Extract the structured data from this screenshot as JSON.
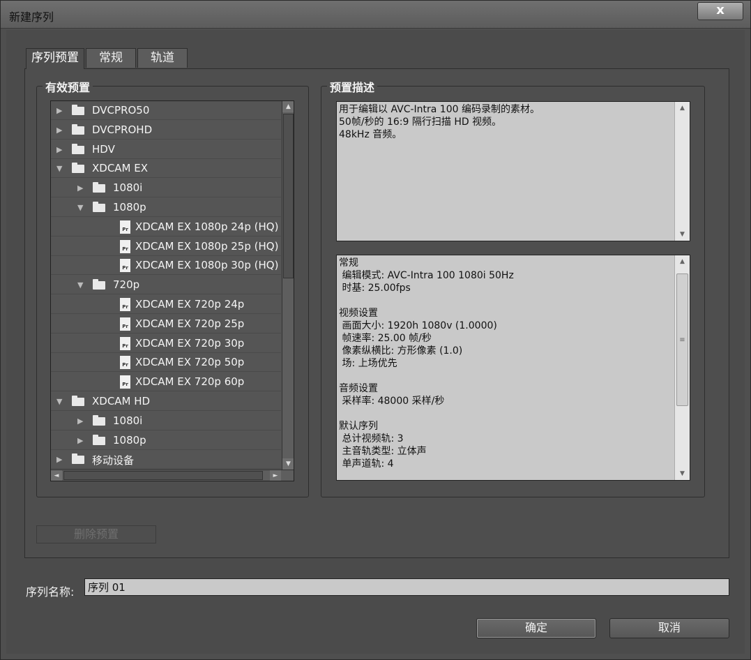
{
  "window": {
    "title": "新建序列",
    "close": "x"
  },
  "tabs": [
    {
      "label": "序列预置",
      "active": true
    },
    {
      "label": "常规",
      "active": false
    },
    {
      "label": "轨道",
      "active": false
    }
  ],
  "presets_group": {
    "label": "有效预置"
  },
  "tree": [
    {
      "label": "DVCPRO50",
      "type": "folder",
      "level": 0,
      "expanded": false
    },
    {
      "label": "DVCPROHD",
      "type": "folder",
      "level": 0,
      "expanded": false
    },
    {
      "label": "HDV",
      "type": "folder",
      "level": 0,
      "expanded": false
    },
    {
      "label": "XDCAM EX",
      "type": "folder",
      "level": 0,
      "expanded": true
    },
    {
      "label": "1080i",
      "type": "folder",
      "level": 1,
      "expanded": false
    },
    {
      "label": "1080p",
      "type": "folder",
      "level": 1,
      "expanded": true
    },
    {
      "label": "XDCAM EX 1080p 24p (HQ)",
      "type": "file",
      "level": 2
    },
    {
      "label": "XDCAM EX 1080p 25p (HQ)",
      "type": "file",
      "level": 2
    },
    {
      "label": "XDCAM EX 1080p 30p (HQ)",
      "type": "file",
      "level": 2
    },
    {
      "label": "720p",
      "type": "folder",
      "level": 1,
      "expanded": true
    },
    {
      "label": "XDCAM EX 720p 24p",
      "type": "file",
      "level": 2
    },
    {
      "label": "XDCAM EX 720p 25p",
      "type": "file",
      "level": 2
    },
    {
      "label": "XDCAM EX 720p 30p",
      "type": "file",
      "level": 2
    },
    {
      "label": "XDCAM EX 720p 50p",
      "type": "file",
      "level": 2
    },
    {
      "label": "XDCAM EX 720p 60p",
      "type": "file",
      "level": 2
    },
    {
      "label": "XDCAM HD",
      "type": "folder",
      "level": 0,
      "expanded": true
    },
    {
      "label": "1080i",
      "type": "folder",
      "level": 1,
      "expanded": false
    },
    {
      "label": "1080p",
      "type": "folder",
      "level": 1,
      "expanded": false
    },
    {
      "label": "移动设备",
      "type": "folder",
      "level": 0,
      "expanded": false
    }
  ],
  "file_icon_text": "Pr",
  "description_group": {
    "label": "预置描述"
  },
  "description_lines": [
    "用于编辑以 AVC-Intra 100 编码录制的素材。",
    "50帧/秒的 16:9 隔行扫描 HD 视频。",
    "48kHz 音频。"
  ],
  "details_lines": [
    "常规",
    " 编辑模式: AVC-Intra 100 1080i 50Hz",
    " 时基: 25.00fps",
    "",
    "视频设置",
    " 画面大小: 1920h 1080v (1.0000)",
    " 帧速率: 25.00 帧/秒",
    " 像素纵横比: 方形像素 (1.0)",
    " 场: 上场优先",
    "",
    "音频设置",
    " 采样率: 48000 采样/秒",
    "",
    "默认序列",
    " 总计视频轨: 3",
    " 主音轨类型: 立体声",
    " 单声道轨: 4"
  ],
  "delete_preset": "删除预置",
  "sequence_name": {
    "label": "序列名称:",
    "value": "序列 01"
  },
  "buttons": {
    "ok": "确定",
    "cancel": "取消"
  },
  "scroll_glyphs": {
    "up": "▲",
    "down": "▼",
    "left": "◄",
    "right": "►",
    "grip": "≡"
  }
}
